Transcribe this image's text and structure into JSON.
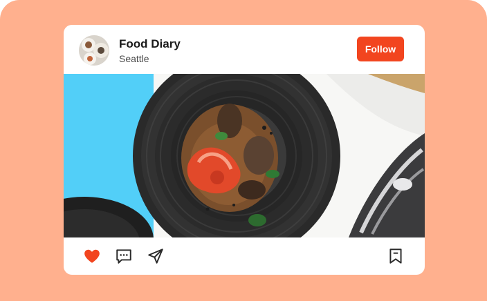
{
  "post": {
    "account_name": "Food Diary",
    "location": "Seattle",
    "follow_label": "Follow"
  },
  "colors": {
    "background": "#FFB08E",
    "accent": "#F2451F",
    "like": "#F2451F"
  },
  "icons": {
    "like": "heart-icon",
    "comment": "comment-icon",
    "share": "send-icon",
    "save": "bookmark-icon"
  }
}
